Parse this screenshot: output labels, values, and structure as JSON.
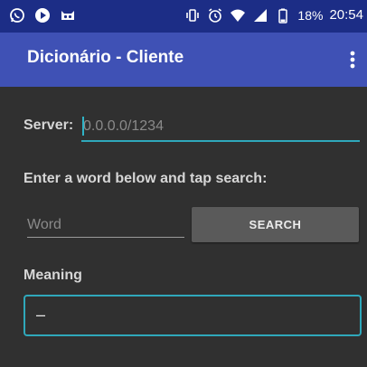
{
  "status_bar": {
    "left_icons": [
      "whatsapp-icon",
      "play-icon",
      "cat-icon"
    ],
    "right_icons": [
      "vibrate-icon",
      "alarm-icon",
      "wifi-icon",
      "signal-icon",
      "battery-icon"
    ],
    "battery": "18%",
    "time": "20:54"
  },
  "toolbar": {
    "title": "Dicionário - Cliente",
    "background": "#3f51b5",
    "status_background": "#1c2d86"
  },
  "form": {
    "server_label": "Server:",
    "server_value": "",
    "server_placeholder": "0.0.0.0/1234",
    "instruction": "Enter a word below and tap search:",
    "word_value": "",
    "word_placeholder": "Word",
    "search_label": "SEARCH",
    "meaning_label": "Meaning",
    "meaning_value": "–",
    "accent": "#2fa8bb"
  }
}
